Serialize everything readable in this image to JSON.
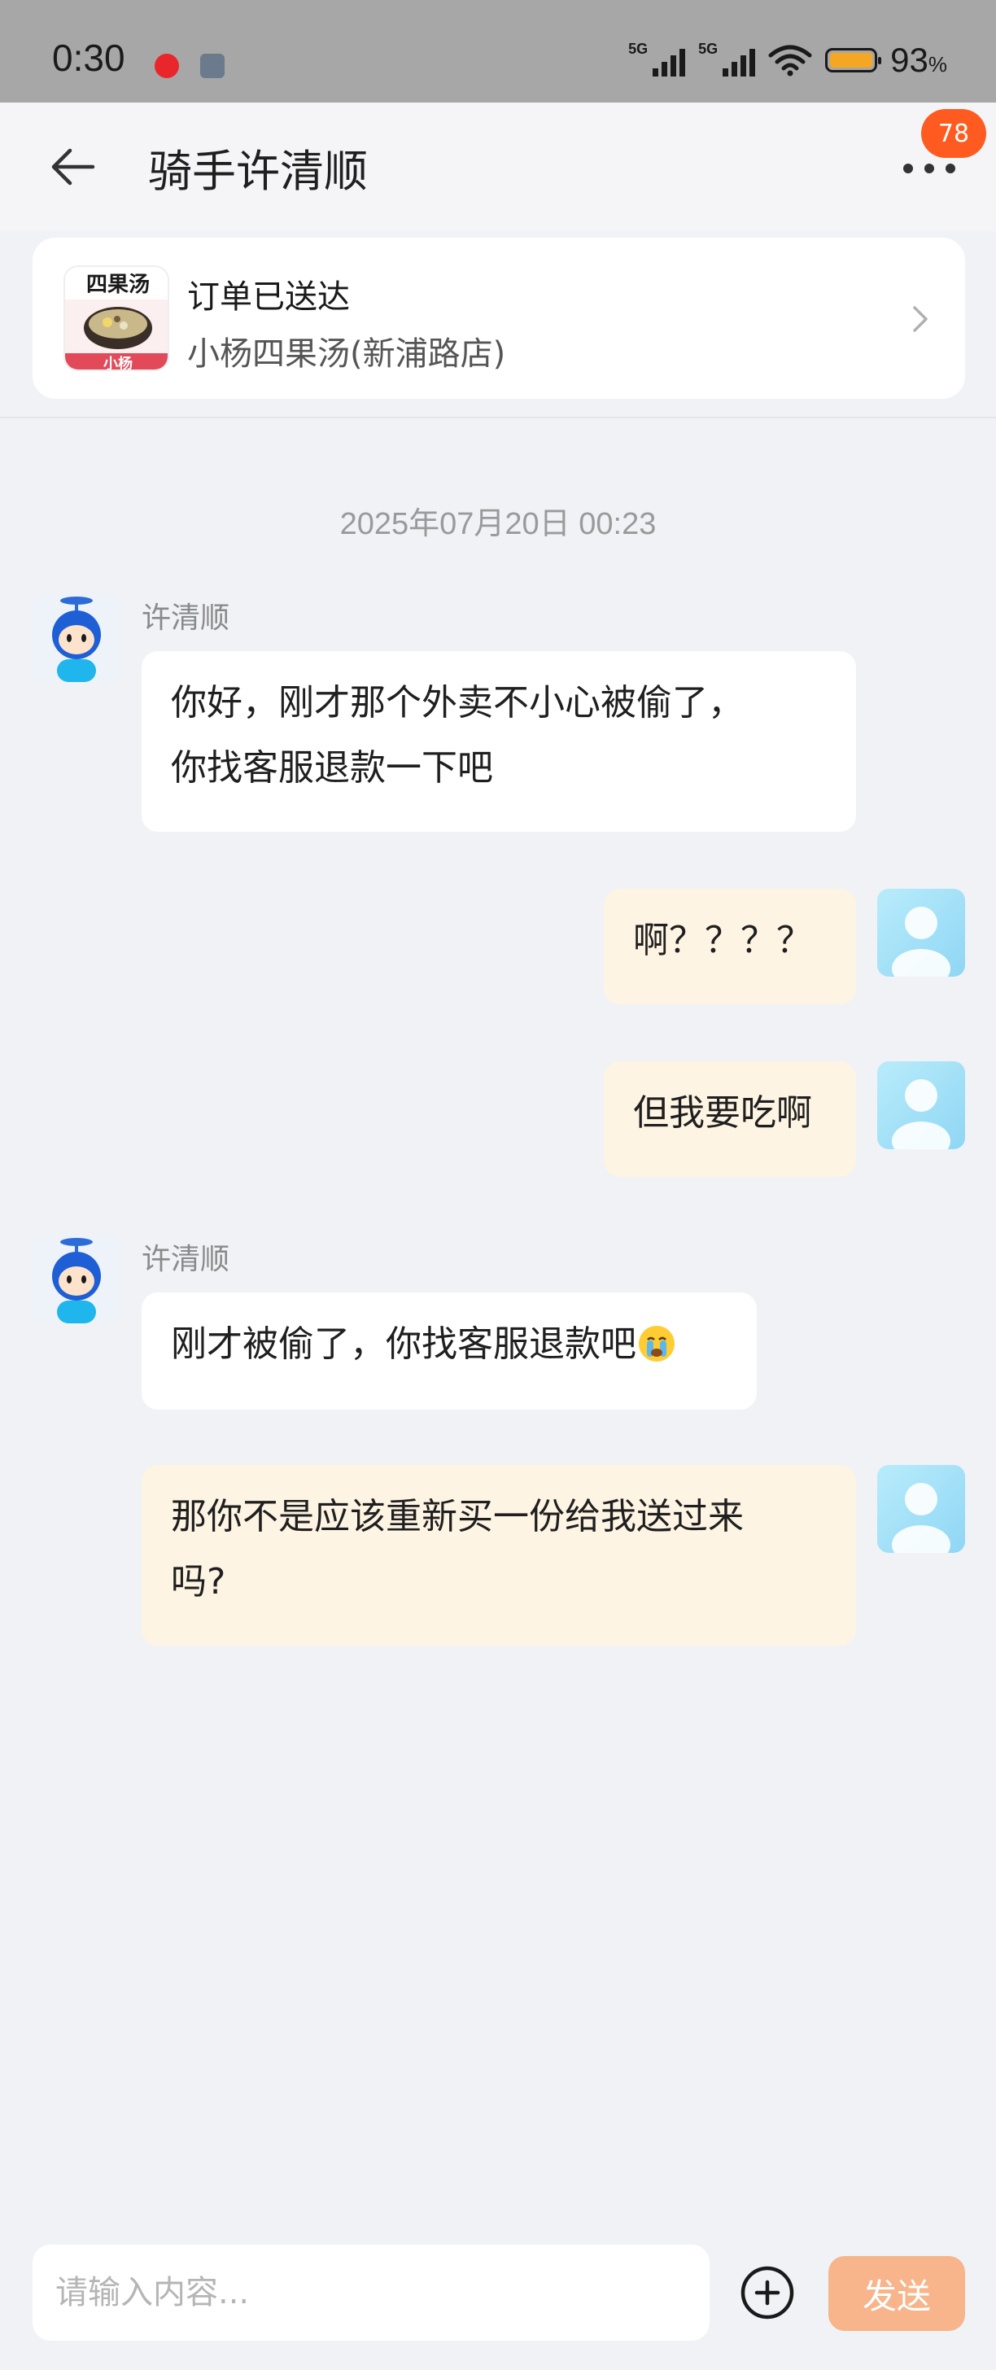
{
  "status_bar": {
    "time": "0:30",
    "signal1_label": "5G",
    "signal2_label": "5G",
    "battery_percent": "93",
    "battery_unit": "%"
  },
  "header": {
    "title": "骑手许清顺",
    "badge_count": "78"
  },
  "order": {
    "status": "订单已送达",
    "shop_name": "小杨四果汤(新浦路店)",
    "logo_top_text": "四果汤",
    "logo_bottom_text": "小杨"
  },
  "chat": {
    "timestamp": "2025年07月20日 00:23",
    "messages": [
      {
        "side": "left",
        "sender": "许清顺",
        "lines": [
          "你好，刚才那个外卖不小心被偷了，",
          "你找客服退款一下吧"
        ]
      },
      {
        "side": "right",
        "lines": [
          "啊？？？？"
        ]
      },
      {
        "side": "right",
        "lines": [
          "但我要吃啊"
        ]
      },
      {
        "side": "left",
        "sender": "许清顺",
        "lines": [
          "刚才被偷了，你找客服退款吧"
        ],
        "emoji": "crying-face"
      },
      {
        "side": "right",
        "lines": [
          "那你不是应该重新买一份给我送过来",
          "吗?"
        ]
      }
    ]
  },
  "composer": {
    "placeholder": "请输入内容...",
    "send_label": "发送"
  },
  "colors": {
    "accent": "#ff5a1f",
    "send_button": "#f8b48a",
    "self_bubble": "#fdf4e3",
    "other_bubble": "#ffffff",
    "background": "#f0f2f6"
  }
}
